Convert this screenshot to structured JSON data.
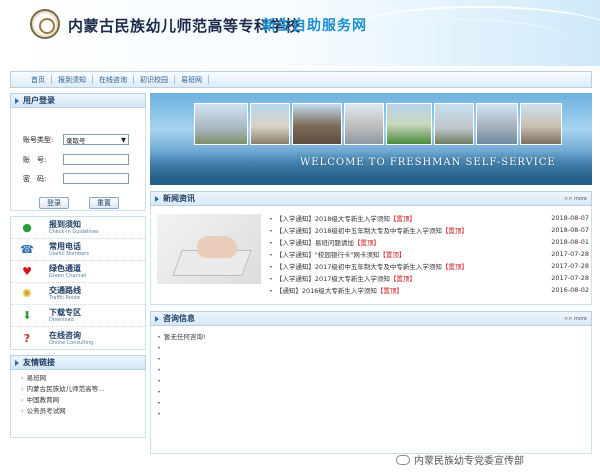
{
  "header": {
    "school_name": "内蒙古民族幼儿师范高等专科学校",
    "service_name": "新生自助服务网"
  },
  "nav": {
    "items": [
      {
        "label": "首页"
      },
      {
        "label": "报到须知"
      },
      {
        "label": "在线咨询"
      },
      {
        "label": "初识校园"
      },
      {
        "label": "易班网"
      }
    ]
  },
  "login": {
    "title": "用户登录",
    "account_type_label": "账号类型:",
    "account_type_value": "录取号",
    "account_label": "账　号:",
    "password_label": "密　码:",
    "login_button": "登录",
    "reset_button": "重置"
  },
  "quick_links": [
    {
      "label": "报到须知",
      "sub": "Check-in Guidelines",
      "icon": "info-icon"
    },
    {
      "label": "常用电话",
      "sub": "Useful Numbers",
      "icon": "phone-icon"
    },
    {
      "label": "绿色通道",
      "sub": "Green Channel",
      "icon": "heart-icon"
    },
    {
      "label": "交通路线",
      "sub": "Traffic Route",
      "icon": "traffic-icon"
    },
    {
      "label": "下载专区",
      "sub": "Download",
      "icon": "download-icon"
    },
    {
      "label": "在线咨询",
      "sub": "Online Consulting",
      "icon": "question-icon"
    }
  ],
  "friend_links": {
    "title": "友情链接",
    "items": [
      {
        "label": "易班网"
      },
      {
        "label": "内蒙古民族幼儿师范高等..."
      },
      {
        "label": "中国教育网"
      },
      {
        "label": "公务员考试网"
      }
    ]
  },
  "banner": {
    "welcome_text": "WELCOME TO FRESHMAN SELF-SERVICE"
  },
  "news": {
    "title": "新闻资讯",
    "more": ">> more",
    "items": [
      {
        "prefix": "【入学通知】2018级大专新生入学须知",
        "hot": "【置顶】",
        "date": "2018-08-07"
      },
      {
        "prefix": "【入学通知】2018级初中五年制大专及中专新生入学须知",
        "hot": "【置顶】",
        "date": "2018-08-07"
      },
      {
        "prefix": "【入学通知】易班问题请加",
        "hot": "【置顶】",
        "date": "2018-08-01"
      },
      {
        "prefix": "【入学通知】\"校园银行卡\"网卡须知",
        "hot": "【置顶】",
        "date": "2017-07-28"
      },
      {
        "prefix": "【入学通知】2017级初中五年制大专及中专新生入学须知",
        "hot": "【置顶】",
        "date": "2017-07-28"
      },
      {
        "prefix": "【入学通知】2017级大专新生入学须知",
        "hot": "【置顶】",
        "date": "2017-07-28"
      },
      {
        "prefix": "【通知】2016级大专新生入学须知",
        "hot": "【置顶】",
        "date": "2016-08-02"
      }
    ]
  },
  "consult": {
    "title": "咨询信息",
    "more": ">> more",
    "empty_text": "暂无任何咨询!"
  },
  "watermark": {
    "text": "内蒙民族幼专党委宣传部"
  },
  "colors": {
    "brand_blue": "#1b8fd0",
    "hot_red": "#d4161a",
    "nav_text": "#2b5e91"
  }
}
